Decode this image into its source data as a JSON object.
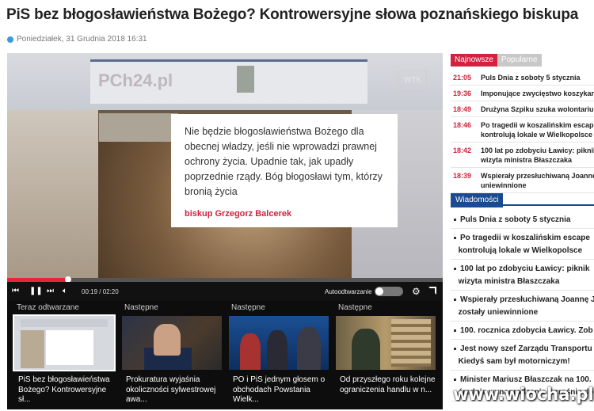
{
  "article": {
    "headline": "PiS bez błogosławieństwa Bożego? Kontrowersyjne słowa poznańskiego biskupa",
    "date": "Poniedziałek, 31 Grudnia 2018 16:31"
  },
  "player": {
    "quote": "Nie będzie błogosławieństwa Bożego dla obecnej władzy, jeśli nie wprowadzi prawnej ochrony życia. Upadnie tak, jak upadły poprzednie rządy. Bóg błogosławi tym, którzy bronią życia",
    "quote_author": "biskup Grzegorz Balcerek",
    "video_logo": "PCh24.pl",
    "video_corner": "WTK",
    "timecode": "00:19 / 02:20",
    "progress": 0.14,
    "autoplay_label": "Autoodtwarzanie",
    "autoplay_on": false,
    "icons": [
      "skip-back-icon",
      "pause-icon",
      "skip-forward-icon",
      "volume-icon",
      "gear-icon",
      "fullscreen-icon"
    ]
  },
  "playlist": [
    {
      "label": "Teraz odtwarzane",
      "title": "PiS bez błogosławieństwa Bożego? Kontrowersyjne sł..."
    },
    {
      "label": "Następne",
      "title": "Prokuratura wyjaśnia okoliczności sylwestrowej awa..."
    },
    {
      "label": "Następne",
      "title": "PO i PiS jednym głosem o obchodach Powstania Wielk..."
    },
    {
      "label": "Następne",
      "title": "Od przyszłego roku kolejne ograniczenia handlu w n..."
    }
  ],
  "sidebar": {
    "tabs": [
      "Najnowsze",
      "Popularne"
    ],
    "latest": [
      {
        "time": "21:05",
        "title": "Puls Dnia z soboty 5 stycznia"
      },
      {
        "time": "19:36",
        "title": "Imponujące zwycięstwo koszykarek"
      },
      {
        "time": "18:49",
        "title": "Drużyna Szpiku szuka wolontariuszy"
      },
      {
        "time": "18:46",
        "title": "Po tragedii w koszalińskim escape",
        "title2": "kontrolują lokale w Wielkopolsce"
      },
      {
        "time": "18:42",
        "title": "100 lat po zdobyciu Ławicy: piknik",
        "title2": "wizyta ministra Błaszczaka"
      },
      {
        "time": "18:39",
        "title": "Wspierały przesłuchiwaną Joannę",
        "title2": "uniewinnione"
      }
    ],
    "section_label": "Wiadomości",
    "news": [
      "Puls Dnia z soboty 5 stycznia",
      "Po tragedii w koszalińskim escape",
      "kontrolują lokale w Wielkopolsce",
      "100 lat po zdobyciu Ławicy: piknik",
      "wizyta ministra Błaszczaka",
      "Wspierały przesłuchiwaną Joannę J",
      "zostały uniewinnione",
      "100. rocznica zdobycia Ławicy. Zob",
      "Jest nowy szef Zarządu Transportu",
      "Kiedyś sam był motorniczym!",
      "Minister Mariusz Błaszczak na 100.",
      "średnie wynagrodzenie wzrośnie do"
    ]
  },
  "watermark": "www.wiocha.pl",
  "colors": {
    "accent": "#d1223f",
    "section": "#1a4a8f"
  }
}
